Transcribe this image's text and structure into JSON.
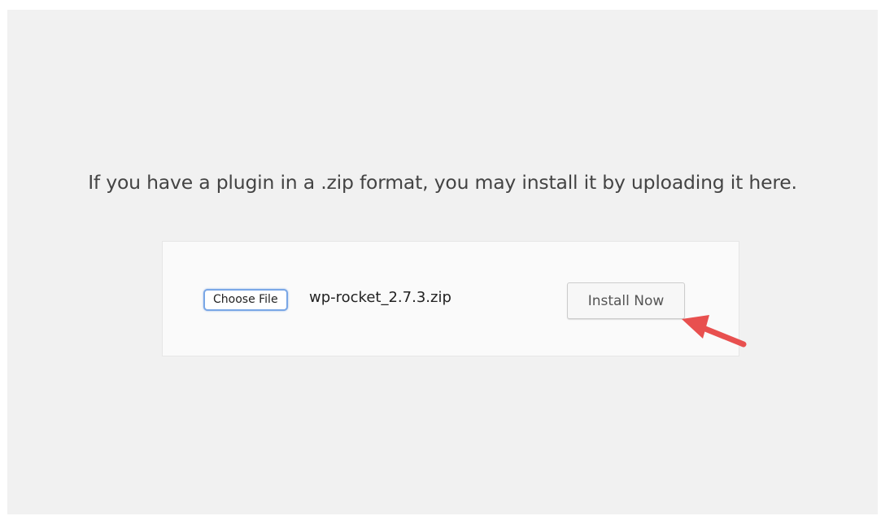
{
  "upload": {
    "description": "If you have a plugin in a .zip format, you may install it by uploading it here.",
    "choose_file_label": "Choose File",
    "selected_file": "wp-rocket_2.7.3.zip",
    "install_label": "Install Now"
  },
  "annotation": {
    "arrow_icon": "red-arrow-icon",
    "arrow_color": "#e8504f"
  },
  "colors": {
    "page_background": "#f1f1f1",
    "panel_background": "#fafafa",
    "focus_border": "#7aa7e6"
  }
}
